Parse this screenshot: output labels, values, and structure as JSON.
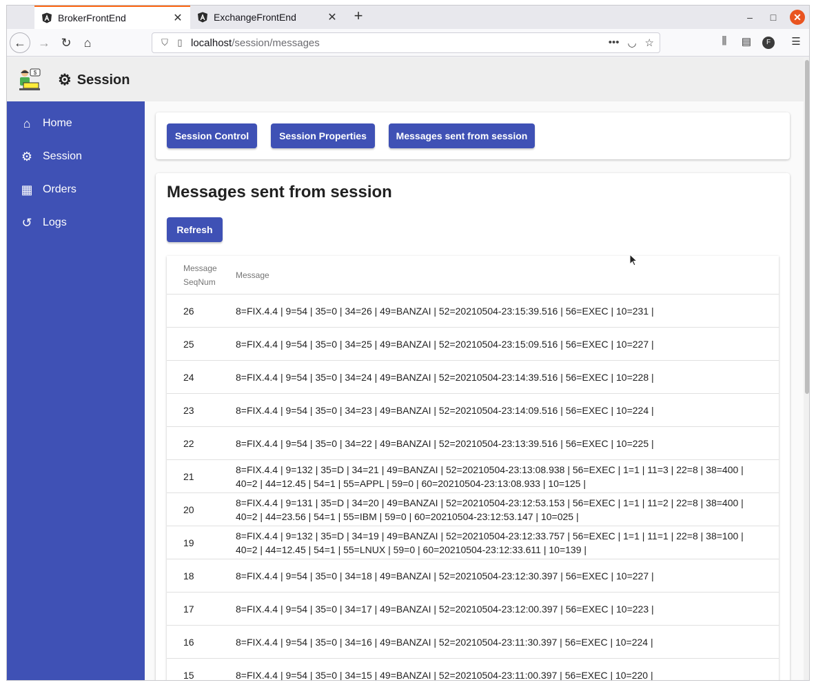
{
  "browser": {
    "tabs": [
      {
        "title": "BrokerFrontEnd",
        "active": true
      },
      {
        "title": "ExchangeFrontEnd",
        "active": false
      }
    ],
    "url_host": "localhost",
    "url_path": "/session/messages",
    "new_tab": "+",
    "close_tab": "✕",
    "minimize": "–",
    "maximize": "□",
    "close_window": "✕",
    "back": "←",
    "forward": "→",
    "reload": "↻",
    "home": "⌂",
    "more": "•••",
    "account_initial": "F"
  },
  "header": {
    "title": "Session"
  },
  "sidebar": {
    "items": [
      {
        "label": "Home",
        "icon": "⌂"
      },
      {
        "label": "Session",
        "icon": "⚙"
      },
      {
        "label": "Orders",
        "icon": "▦"
      },
      {
        "label": "Logs",
        "icon": "↺"
      }
    ]
  },
  "tabs_card": {
    "buttons": [
      "Session Control",
      "Session Properties",
      "Messages sent from session"
    ]
  },
  "main": {
    "title": "Messages sent from session",
    "refresh_label": "Refresh",
    "table": {
      "headers": [
        "Message\nSeqNum",
        "Message"
      ],
      "header_seq_line1": "Message",
      "header_seq_line2": "SeqNum",
      "header_msg": "Message",
      "rows": [
        {
          "seq": "26",
          "msg": "8=FIX.4.4 | 9=54 | 35=0 | 34=26 | 49=BANZAI | 52=20210504-23:15:39.516 | 56=EXEC | 10=231 |"
        },
        {
          "seq": "25",
          "msg": "8=FIX.4.4 | 9=54 | 35=0 | 34=25 | 49=BANZAI | 52=20210504-23:15:09.516 | 56=EXEC | 10=227 |"
        },
        {
          "seq": "24",
          "msg": "8=FIX.4.4 | 9=54 | 35=0 | 34=24 | 49=BANZAI | 52=20210504-23:14:39.516 | 56=EXEC | 10=228 |"
        },
        {
          "seq": "23",
          "msg": "8=FIX.4.4 | 9=54 | 35=0 | 34=23 | 49=BANZAI | 52=20210504-23:14:09.516 | 56=EXEC | 10=224 |"
        },
        {
          "seq": "22",
          "msg": "8=FIX.4.4 | 9=54 | 35=0 | 34=22 | 49=BANZAI | 52=20210504-23:13:39.516 | 56=EXEC | 10=225 |"
        },
        {
          "seq": "21",
          "msg": "8=FIX.4.4 | 9=132 | 35=D | 34=21 | 49=BANZAI | 52=20210504-23:13:08.938 | 56=EXEC | 1=1 | 11=3 | 22=8 | 38=400 | 40=2 | 44=12.45 | 54=1 | 55=APPL | 59=0 | 60=20210504-23:13:08.933 | 10=125 |"
        },
        {
          "seq": "20",
          "msg": "8=FIX.4.4 | 9=131 | 35=D | 34=20 | 49=BANZAI | 52=20210504-23:12:53.153 | 56=EXEC | 1=1 | 11=2 | 22=8 | 38=400 | 40=2 | 44=23.56 | 54=1 | 55=IBM | 59=0 | 60=20210504-23:12:53.147 | 10=025 |"
        },
        {
          "seq": "19",
          "msg": "8=FIX.4.4 | 9=132 | 35=D | 34=19 | 49=BANZAI | 52=20210504-23:12:33.757 | 56=EXEC | 1=1 | 11=1 | 22=8 | 38=100 | 40=2 | 44=12.45 | 54=1 | 55=LNUX | 59=0 | 60=20210504-23:12:33.611 | 10=139 |"
        },
        {
          "seq": "18",
          "msg": "8=FIX.4.4 | 9=54 | 35=0 | 34=18 | 49=BANZAI | 52=20210504-23:12:30.397 | 56=EXEC | 10=227 |"
        },
        {
          "seq": "17",
          "msg": "8=FIX.4.4 | 9=54 | 35=0 | 34=17 | 49=BANZAI | 52=20210504-23:12:00.397 | 56=EXEC | 10=223 |"
        },
        {
          "seq": "16",
          "msg": "8=FIX.4.4 | 9=54 | 35=0 | 34=16 | 49=BANZAI | 52=20210504-23:11:30.397 | 56=EXEC | 10=224 |"
        },
        {
          "seq": "15",
          "msg": "8=FIX.4.4 | 9=54 | 35=0 | 34=15 | 49=BANZAI | 52=20210504-23:11:00.397 | 56=EXEC | 10=220 |"
        }
      ]
    }
  },
  "colors": {
    "primary": "#3f51b5",
    "tab_accent": "#ff6611",
    "close_button": "#e95420"
  }
}
